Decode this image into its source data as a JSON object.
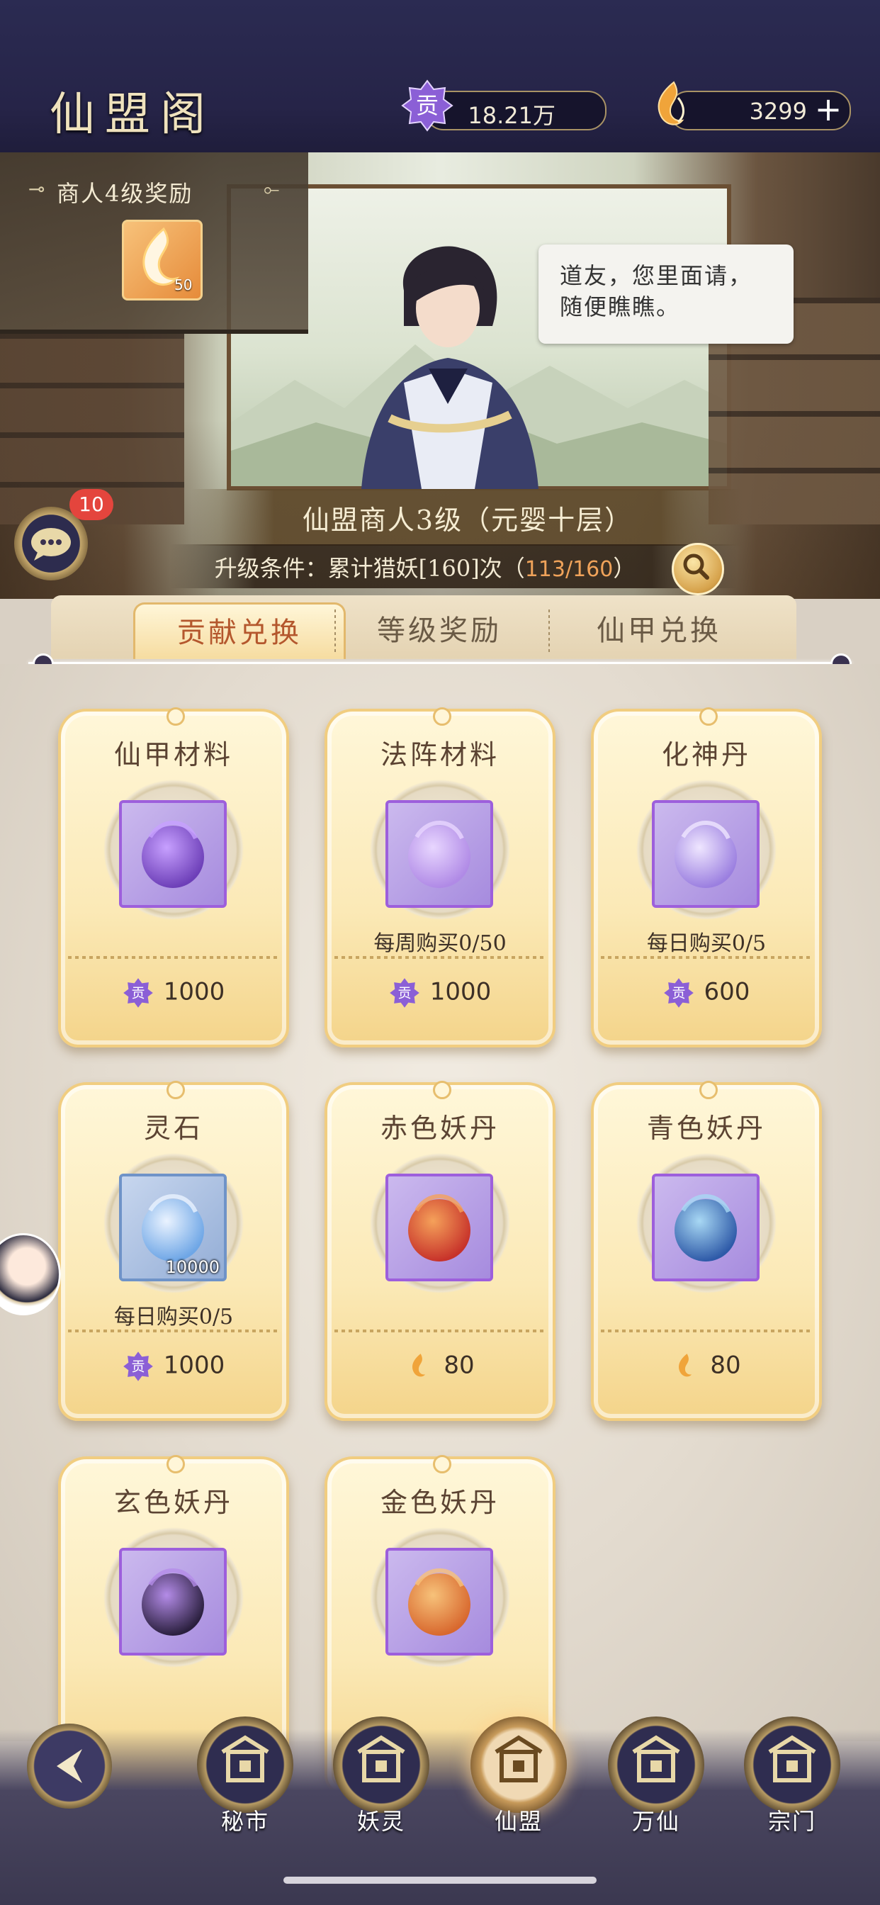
{
  "header": {
    "title": "仙盟阁",
    "currencies": [
      {
        "icon": "contribution-icon",
        "value": "18.21万"
      },
      {
        "icon": "flame-coin-icon",
        "value": "3299",
        "add_label": "+"
      }
    ]
  },
  "reward_panel": {
    "title": "商人4级奖励",
    "item": {
      "icon": "flame-coin-icon",
      "count": "50"
    }
  },
  "merchant": {
    "speech": [
      "道友，您里面请，",
      "随便瞧瞧。"
    ],
    "level_name": "仙盟商人3级（元婴十层）",
    "condition_label": "升级条件：累计猎妖[160]次（",
    "condition_progress": "113/160",
    "condition_suffix": "）"
  },
  "chat": {
    "badge": "10"
  },
  "tabs": [
    {
      "label": "贡献兑换",
      "active": true
    },
    {
      "label": "等级奖励",
      "active": false
    },
    {
      "label": "仙甲兑换",
      "active": false
    }
  ],
  "items": [
    {
      "name": "仙甲材料",
      "icon": "purple-pouch-icon",
      "limit": "",
      "currency": "contribution-icon",
      "price": "1000",
      "frame": "purple"
    },
    {
      "name": "法阵材料",
      "icon": "lavender-pouch-icon",
      "limit": "每周购买0/50",
      "currency": "contribution-icon",
      "price": "1000",
      "frame": "purple"
    },
    {
      "name": "化神丹",
      "icon": "gourd-icon",
      "limit": "每日购买0/5",
      "currency": "contribution-icon",
      "price": "600",
      "frame": "purple"
    },
    {
      "name": "灵石",
      "icon": "spirit-stone-icon",
      "qty": "10000",
      "limit": "每日购买0/5",
      "currency": "contribution-icon",
      "price": "1000",
      "frame": "blue"
    },
    {
      "name": "赤色妖丹",
      "icon": "red-orb-icon",
      "limit": "",
      "currency": "flame-coin-icon",
      "price": "80",
      "frame": "purple"
    },
    {
      "name": "青色妖丹",
      "icon": "blue-orb-icon",
      "limit": "",
      "currency": "flame-coin-icon",
      "price": "80",
      "frame": "purple"
    },
    {
      "name": "玄色妖丹",
      "icon": "dark-orb-icon",
      "limit": "",
      "currency": "",
      "price": "",
      "frame": "purple"
    },
    {
      "name": "金色妖丹",
      "icon": "orange-orb-icon",
      "limit": "",
      "currency": "",
      "price": "",
      "frame": "purple"
    }
  ],
  "bottom_nav": [
    {
      "label": "秘市",
      "icon": "market-gate-icon",
      "active": false
    },
    {
      "label": "妖灵",
      "icon": "fox-spirit-icon",
      "active": false
    },
    {
      "label": "仙盟",
      "icon": "alliance-gate-icon",
      "active": true
    },
    {
      "label": "万仙",
      "icon": "crossed-swords-icon",
      "active": false
    },
    {
      "label": "宗门",
      "icon": "sect-icon",
      "active": false
    }
  ],
  "colors": {
    "header_bg": "#2b2b52",
    "tab_active_text": "#b4572d",
    "progress_text": "#f0a35a",
    "purple_frame": "#9d5fdc",
    "card_border": "#f1cd80"
  }
}
